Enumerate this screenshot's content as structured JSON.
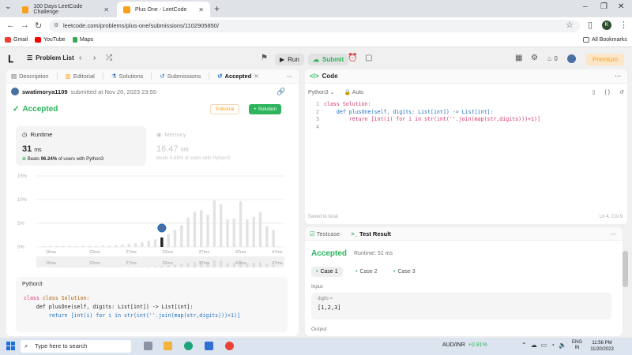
{
  "browser": {
    "tabs": [
      {
        "title": "100 Days LeetCode Challenge",
        "active": false
      },
      {
        "title": "Plus One - LeetCode",
        "active": true
      }
    ],
    "url": "leetcode.com/problems/plus-one/submissions/1102905850/",
    "bookmarks": [
      "Gmail",
      "YouTube",
      "Maps"
    ],
    "all_bookmarks": "All Bookmarks",
    "profile_initial": "K"
  },
  "lc_nav": {
    "problem_list": "Problem List",
    "run": "Run",
    "submit": "Submit",
    "fire_count": "0",
    "premium": "Premium"
  },
  "left": {
    "tabs": [
      {
        "label": "Description",
        "icon": "description-icon"
      },
      {
        "label": "Editorial",
        "icon": "editorial-icon"
      },
      {
        "label": "Solutions",
        "icon": "solutions-icon"
      },
      {
        "label": "Submissions",
        "icon": "submissions-icon"
      },
      {
        "label": "Accepted",
        "icon": "accepted-icon"
      }
    ],
    "user": "swatimorya1109",
    "submitted_text": "submitted at Nov 20, 2023 23:55",
    "status": "Accepted",
    "editorial_btn": "Editorial",
    "solution_btn": "+ Solution",
    "runtime": {
      "title": "Runtime",
      "value": "31",
      "unit": "ms",
      "beats_prefix": "Beats",
      "beats_pct": "96.24%",
      "beats_suffix": "of users with Python3"
    },
    "memory": {
      "title": "Memory",
      "value": "16.47",
      "unit": "MB",
      "beats_text": "Beats 5.68% of users with Python3"
    },
    "code_lang": "Python3",
    "code_lines": [
      "class Solution:",
      "    def plusOne(self, digits: List[int]) -> List[int]:",
      "        return [int(i) for i in str(int(''.join(map(str,digits)))+1)]"
    ]
  },
  "chart_data": {
    "type": "bar",
    "y_ticks": [
      "15%",
      "10%",
      "5%",
      "0%"
    ],
    "ylim": [
      0,
      15
    ],
    "x_ticks": [
      "16ms",
      "22ms",
      "27ms",
      "32ms",
      "37ms",
      "42ms",
      "47ms"
    ],
    "range_ticks": [
      "16ms",
      "22ms",
      "27ms",
      "32ms",
      "37ms",
      "42ms",
      "47ms"
    ],
    "x_range": [
      14,
      48
    ],
    "values": [
      0.2,
      0.2,
      0.2,
      0.2,
      0.2,
      0.2,
      0.2,
      0.2,
      0.2,
      0.3,
      0.3,
      0.4,
      0.5,
      0.6,
      0.8,
      1.0,
      1.3,
      1.6,
      2.0,
      2.8,
      3.6,
      4.6,
      6.2,
      7.4,
      7.8,
      6.8,
      9.8,
      9.0,
      5.8,
      6.0,
      9.6,
      5.8,
      6.4,
      7.4,
      4.4,
      3.6
    ],
    "bar_x_start": 15,
    "bar_x_step": 0.9,
    "highlight_index": 18,
    "highlight_label": "31ms"
  },
  "right": {
    "code_title": "Code",
    "lang": "Python3",
    "mode": "Auto",
    "line_numbers": [
      "1",
      "2",
      "3",
      "4"
    ],
    "code_lines": [
      "class Solution:",
      "    def plusOne(self, digits: List[int]) -> List[int]:",
      "        return [int(i) for i in str(int(''.join(map(str,digits)))+1)]",
      ""
    ],
    "saved": "Saved to local",
    "cursor": "Ln 4, Col 9",
    "test_tabs": [
      "Testcase",
      "Test Result"
    ],
    "result_status": "Accepted",
    "result_runtime": "Runtime: 51 ms",
    "cases": [
      "Case 1",
      "Case 2",
      "Case 3"
    ],
    "input_label": "Input",
    "var_name": "digits =",
    "var_value": "[1,2,3]",
    "output_label": "Output"
  },
  "taskbar": {
    "search_placeholder": "Type here to search",
    "fx_pair": "AUD/INR",
    "fx_change": "+0.91%",
    "lang_top": "ENG",
    "lang_bottom": "IN",
    "time": "11:56 PM",
    "date": "11/20/2023"
  },
  "colors": {
    "accent_green": "#2db55d",
    "premium": "#ffa116",
    "chrome": "#dfe3e8"
  }
}
